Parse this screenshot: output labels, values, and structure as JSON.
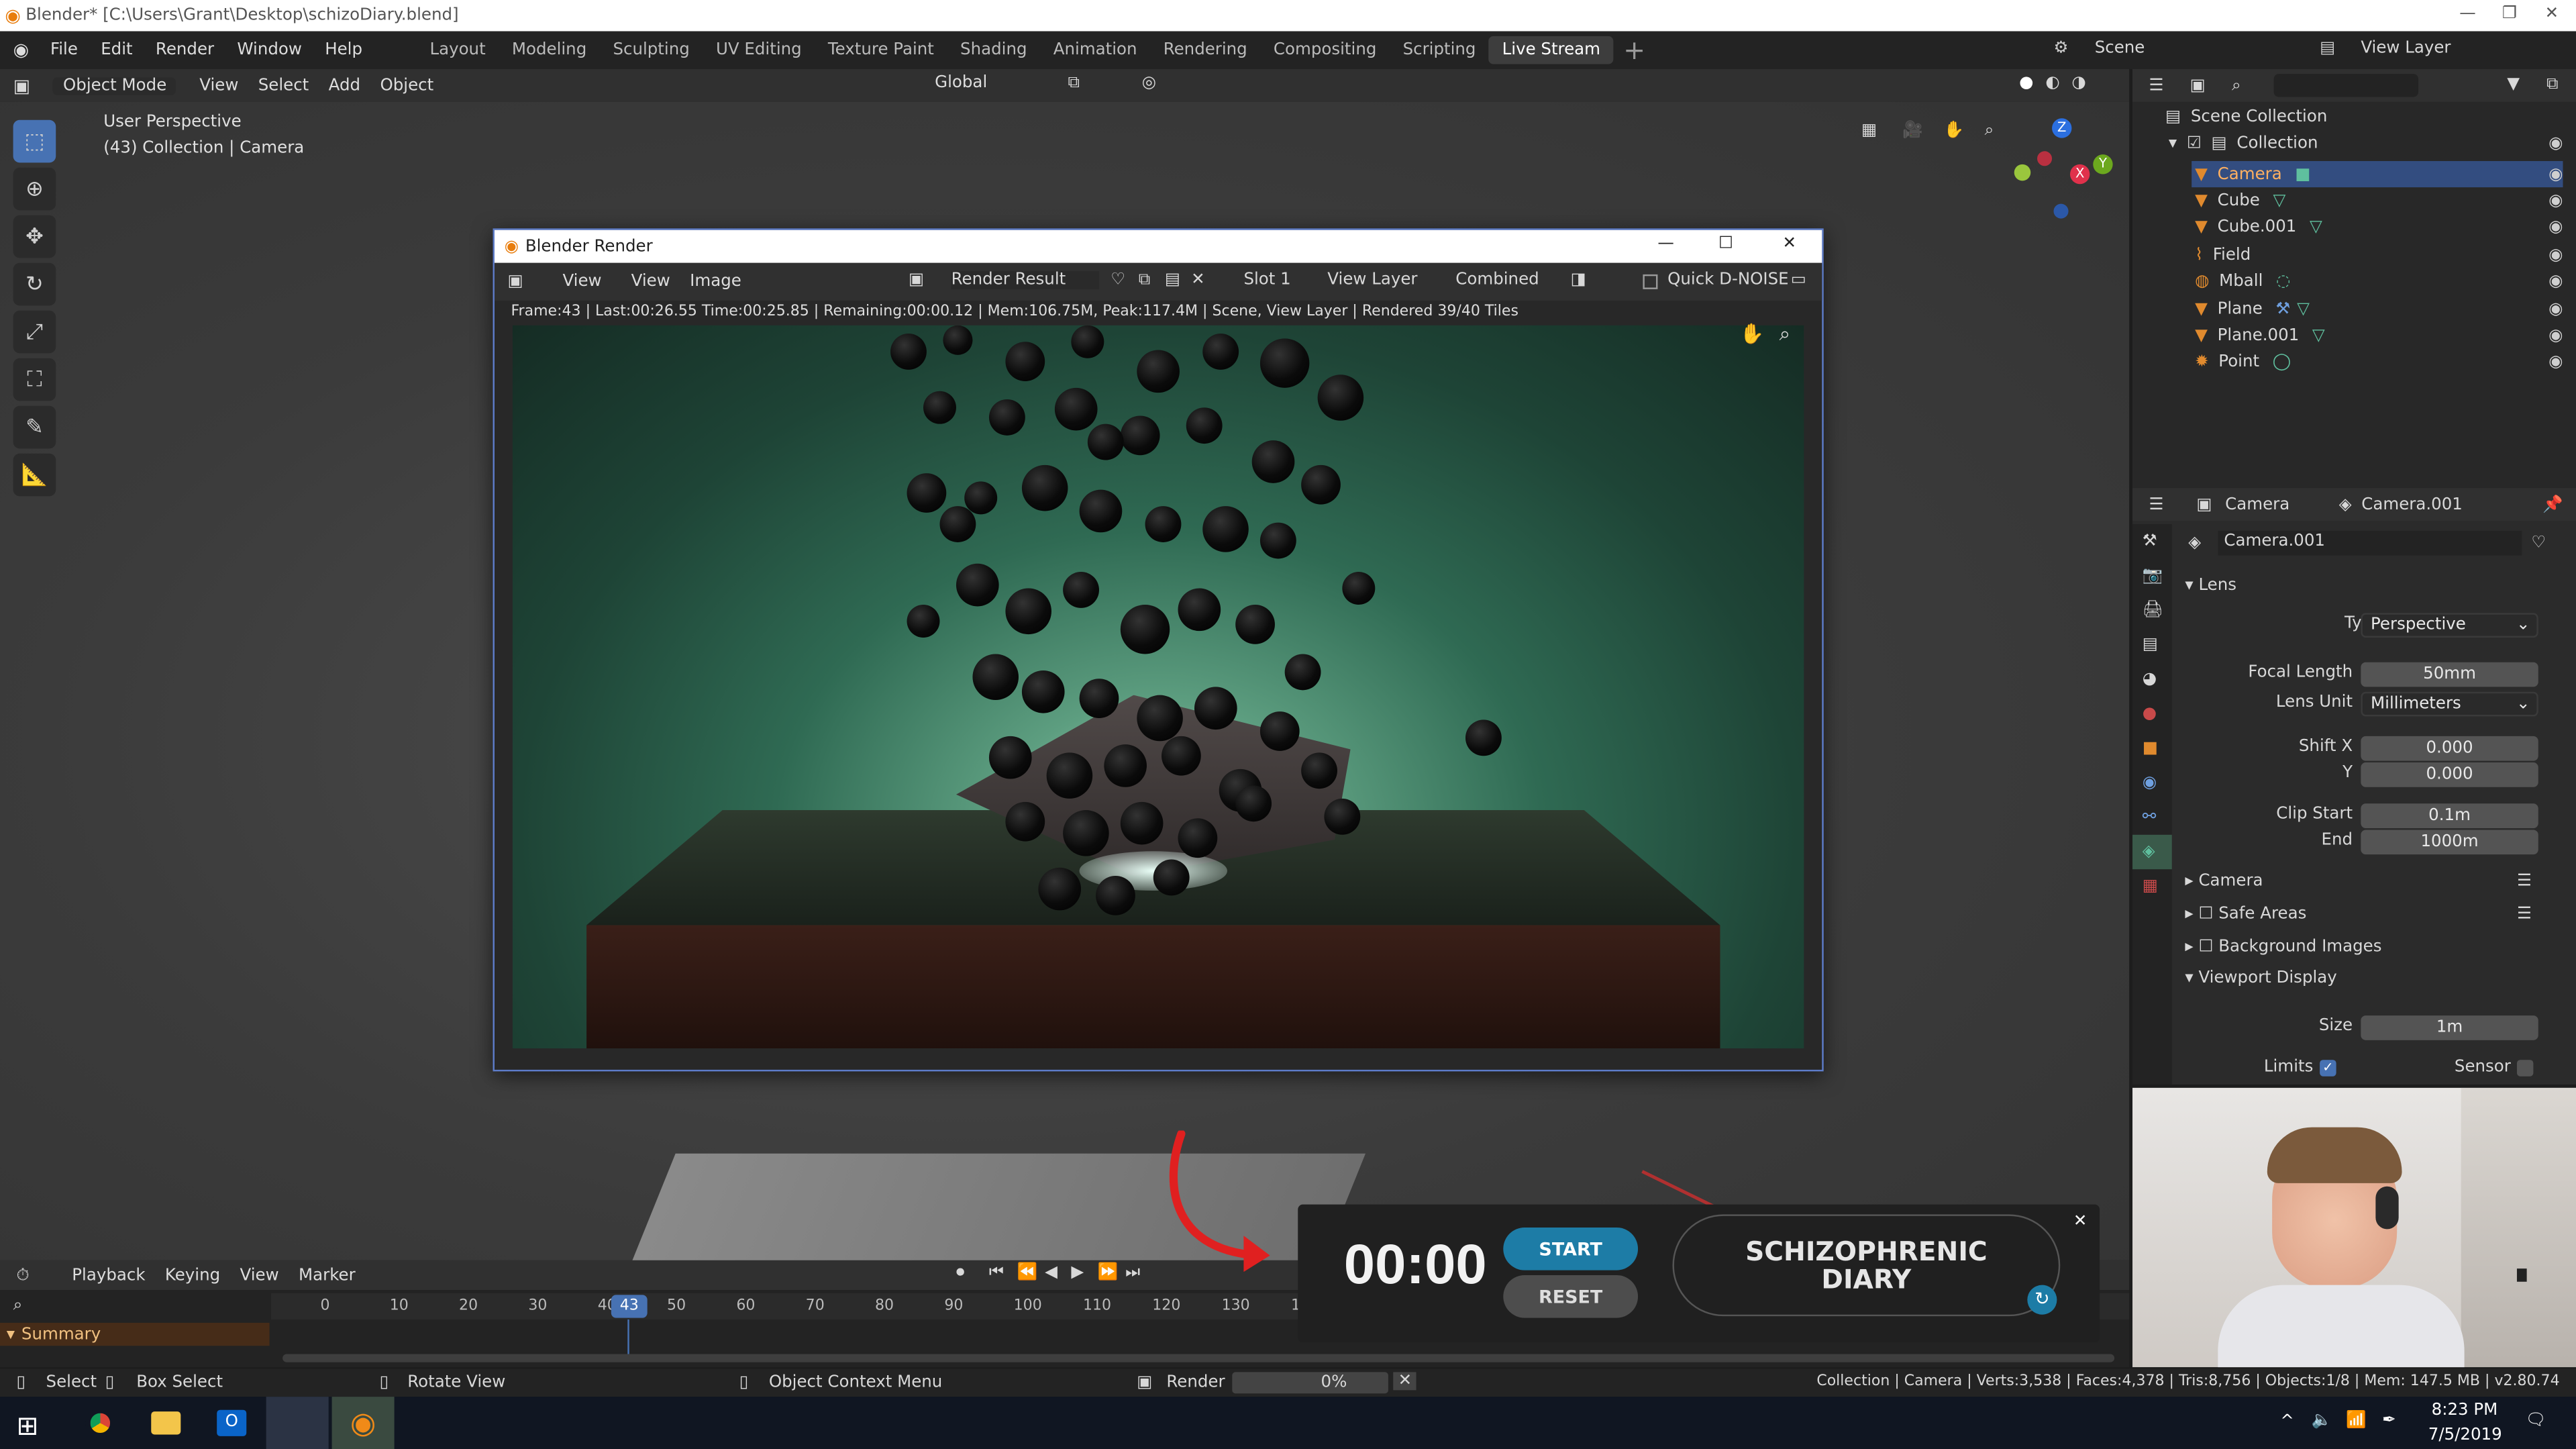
{
  "window": {
    "title": "Blender* [C:\\Users\\Grant\\Desktop\\schizoDiary.blend]"
  },
  "menu": [
    "File",
    "Edit",
    "Render",
    "Window",
    "Help"
  ],
  "workspaces": [
    "Layout",
    "Modeling",
    "Sculpting",
    "UV Editing",
    "Texture Paint",
    "Shading",
    "Animation",
    "Rendering",
    "Compositing",
    "Scripting",
    "Live Stream"
  ],
  "active_workspace": "Live Stream",
  "scene": {
    "scene_label": "Scene",
    "view_layer_label": "View Layer"
  },
  "viewport_header": {
    "mode": "Object Mode",
    "view": "View",
    "select": "Select",
    "add": "Add",
    "object": "Object",
    "transform": "Global"
  },
  "viewport": {
    "perspective": "User Perspective",
    "context": "(43) Collection | Camera"
  },
  "render_window": {
    "title": "Blender Render",
    "menu": [
      "View",
      "View",
      "Image"
    ],
    "image_name": "Render Result",
    "slot": "Slot 1",
    "layer": "View Layer",
    "pass": "Combined",
    "denoise": "Quick D-NOISE",
    "status": "Frame:43 | Last:00:26.55 Time:00:25.85 | Remaining:00:00.12 | Mem:106.75M, Peak:117.4M | Scene, View Layer | Rendered 39/40 Tiles"
  },
  "outliner": {
    "root": "Scene Collection",
    "collection": "Collection",
    "items": [
      "Camera",
      "Cube",
      "Cube.001",
      "Field",
      "Mball",
      "Plane",
      "Plane.001",
      "Point"
    ],
    "active": "Camera"
  },
  "properties": {
    "tab1": "Camera",
    "tab2": "Camera.001",
    "datablock": "Camera.001",
    "lens_panel": "Lens",
    "type_label": "Type",
    "type_value": "Perspective",
    "focal_label": "Focal Length",
    "focal_value": "50mm",
    "unit_label": "Lens Unit",
    "unit_value": "Millimeters",
    "shiftx_label": "Shift X",
    "shiftx_value": "0.000",
    "shifty_label": "Y",
    "shifty_value": "0.000",
    "clipstart_label": "Clip Start",
    "clipstart_value": "0.1m",
    "clipend_label": "End",
    "clipend_value": "1000m",
    "camera_panel": "Camera",
    "safe_areas": "Safe Areas",
    "bg_images": "Background Images",
    "viewport_display": "Viewport Display",
    "size_label": "Size",
    "size_value": "1m",
    "limits_label": "Limits",
    "sensor_label": "Sensor"
  },
  "timeline": {
    "menu": [
      "Playback",
      "Keying",
      "View",
      "Marker"
    ],
    "ticks": [
      "0",
      "10",
      "20",
      "30",
      "40",
      "50",
      "60",
      "70",
      "80",
      "90",
      "100",
      "110",
      "120",
      "130",
      "1"
    ],
    "current_frame": "43",
    "summary": "Summary"
  },
  "timer_overlay": {
    "time": "00:00",
    "start": "START",
    "reset": "RESET",
    "title_line1": "SCHIZOPHRENIC",
    "title_line2": "DIARY"
  },
  "statusbar": {
    "select": "Select",
    "box_select": "Box Select",
    "rotate": "Rotate View",
    "context_menu": "Object Context Menu",
    "render": "Render",
    "render_progress": "0%",
    "stats": "Collection | Camera | Verts:3,538 | Faces:4,378 | Tris:8,756 | Objects:1/8 | Mem: 147.5 MB | v2.80.74"
  },
  "taskbar": {
    "time": "8:23 PM",
    "date": "7/5/2019"
  },
  "colors": {
    "accent": "#4772b3",
    "start_button": "#1d7ca6",
    "arrow": "#e02020",
    "outliner_active": "#e08a2e"
  }
}
